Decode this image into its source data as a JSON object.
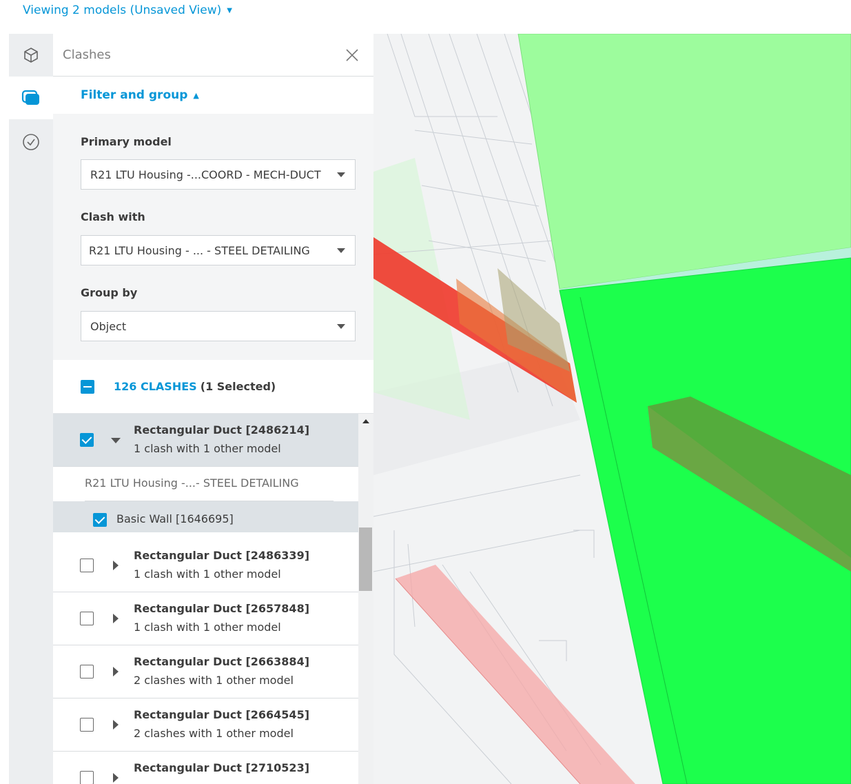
{
  "header": {
    "view_label": "Viewing 2 models (Unsaved View)"
  },
  "rail": {
    "items": [
      "model-icon",
      "clashes-icon",
      "issues-icon"
    ],
    "active": "clashes-icon"
  },
  "panel": {
    "title": "Clashes",
    "filter_toggle": "Filter and group",
    "primary_model_label": "Primary model",
    "primary_model_value": "R21 LTU Housing -...COORD - MECH-DUCT",
    "clash_with_label": "Clash with",
    "clash_with_value": "R21 LTU Housing - ... - STEEL DETAILING",
    "group_by_label": "Group by",
    "group_by_value": "Object",
    "clash_count": "126 CLASHES",
    "selected_text": "(1 Selected)"
  },
  "list": {
    "expanded": {
      "title": "Rectangular Duct [2486214]",
      "subtitle": "1 clash with 1 other model",
      "checked": true,
      "sub_model": "R21 LTU Housing -...- STEEL DETAILING",
      "sub_item": "Basic Wall [1646695]"
    },
    "rows": [
      {
        "title": "Rectangular Duct [2486339]",
        "subtitle": "1 clash with 1 other model"
      },
      {
        "title": "Rectangular Duct [2657848]",
        "subtitle": "1 clash with 1 other model"
      },
      {
        "title": "Rectangular Duct [2663884]",
        "subtitle": "2 clashes with 1 other model"
      },
      {
        "title": "Rectangular Duct [2664545]",
        "subtitle": "2 clashes with 1 other model"
      },
      {
        "title": "Rectangular Duct [2710523]",
        "subtitle": ""
      }
    ]
  },
  "colors": {
    "accent": "#0696d7",
    "clash_green": "#22ff55",
    "clash_red": "#f0392b"
  }
}
